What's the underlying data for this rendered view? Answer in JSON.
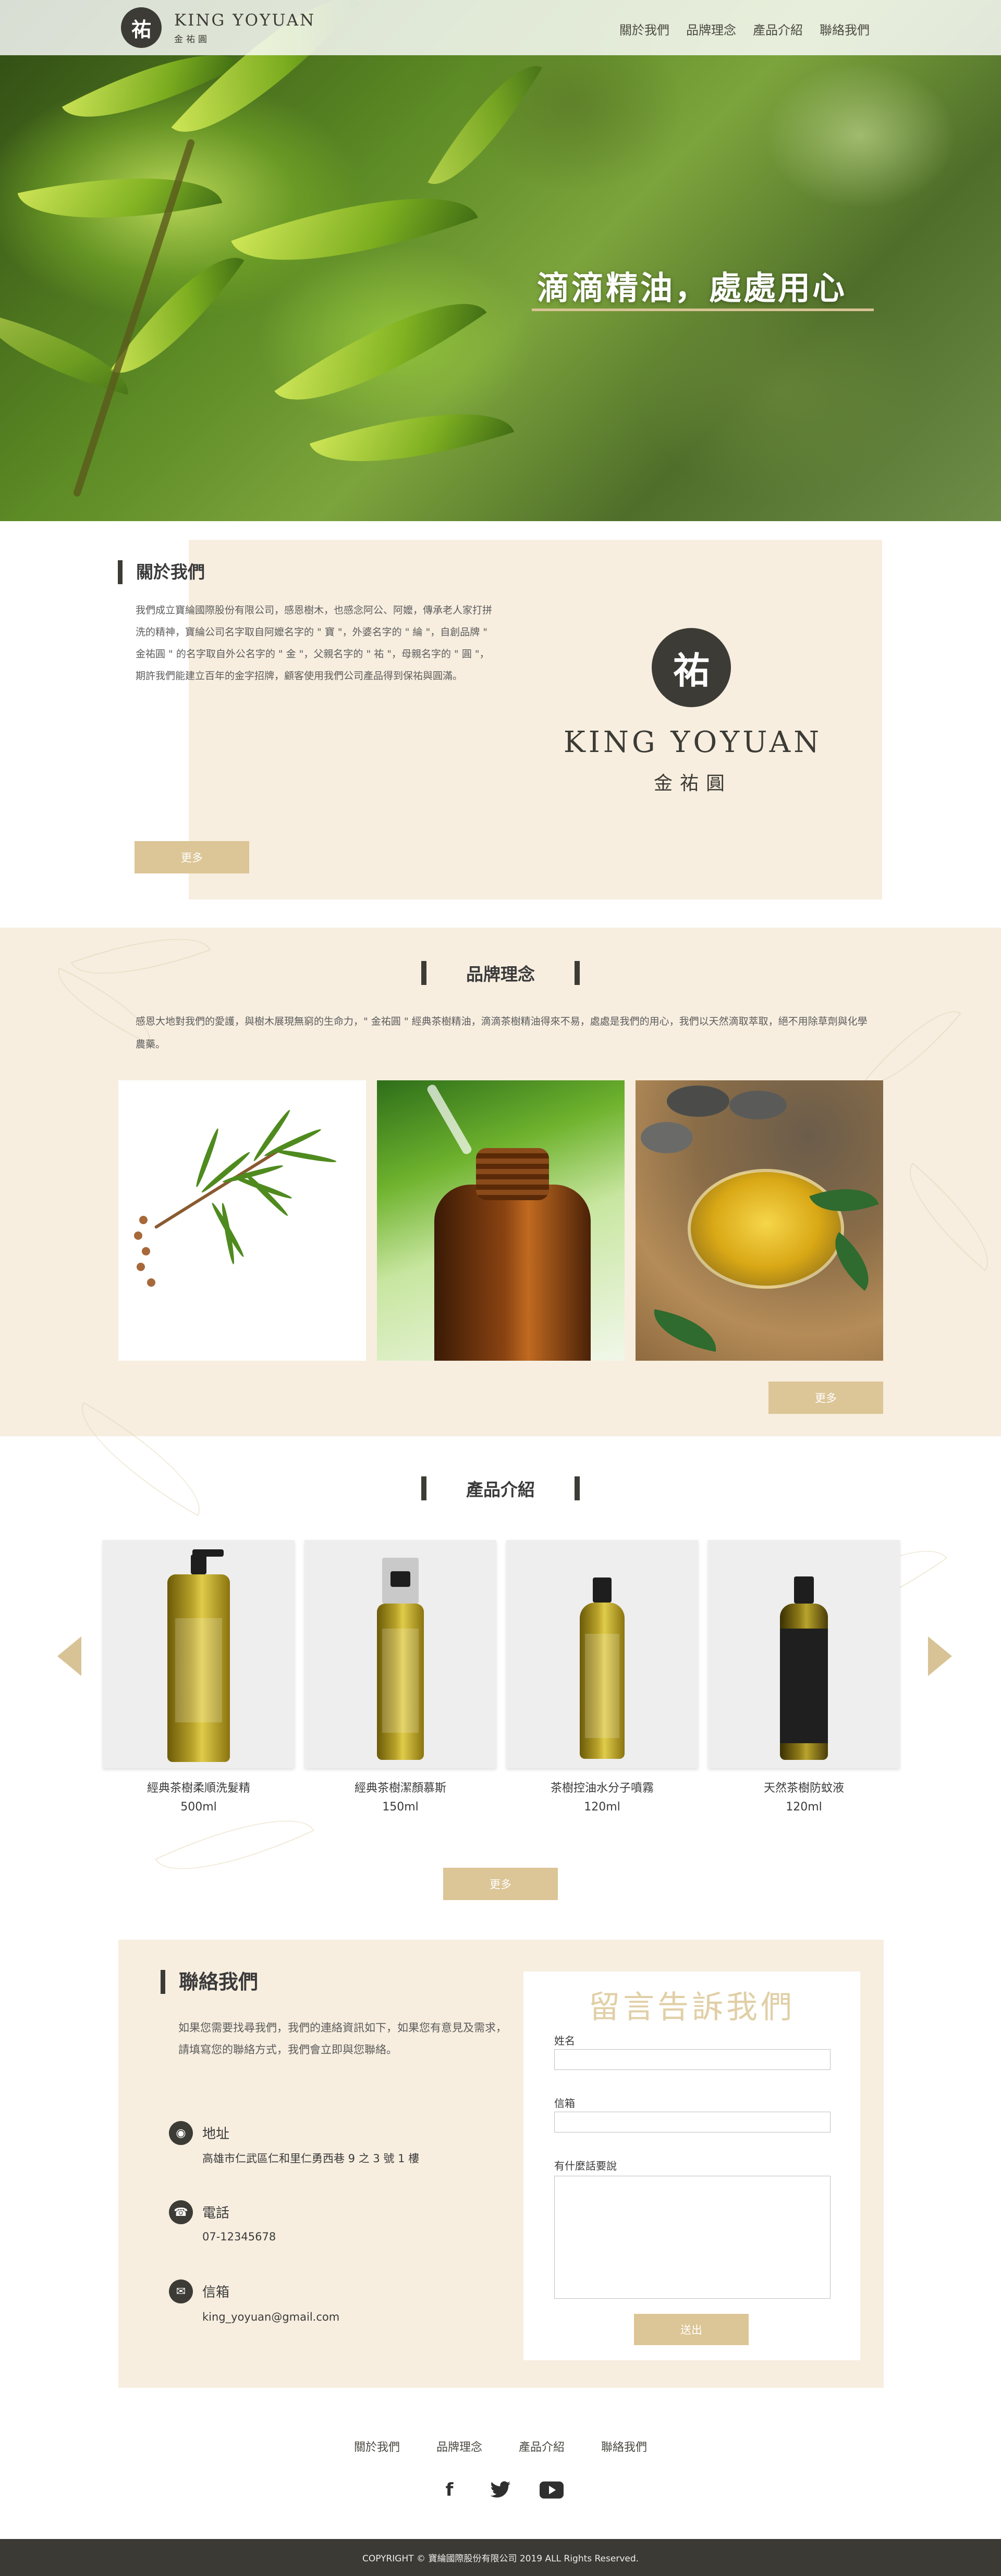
{
  "header": {
    "logo_mark": "祐",
    "logo_en": "KING YOYUAN",
    "logo_zh": "金祐圓",
    "nav": [
      "關於我們",
      "品牌理念",
      "產品介紹",
      "聯絡我們"
    ]
  },
  "hero": {
    "title": "滴滴精油，處處用心"
  },
  "about": {
    "title": "關於我們",
    "text": "我們成立寶綸國際股份有限公司，感恩樹木，也感念阿公、阿嬤，傳承老人家打拼洗的精神，寶綸公司名字取自阿嬤名字的 \" 寶 \"，外婆名字的 \" 綸 \"，自創品牌 \" 金祐圓 \" 的名字取自外公名字的 \" 金 \"，父親名字的 \" 祐 \"，母親名字的 \" 圓 \"，期許我們能建立百年的金字招牌，顧客使用我們公司產品得到保祐與圓滿。",
    "more": "更多",
    "logo_mark": "祐",
    "logo_en": "KING YOYUAN",
    "logo_zh": "金祐圓"
  },
  "brand": {
    "title": "品牌理念",
    "text": "感恩大地對我們的愛護，與樹木展現無窮的生命力，\" 金祐圓 \" 經典茶樹精油，滴滴茶樹精油得來不易，處處是我們的用心，我們以天然滴取萃取，絕不用除草劑與化學農藥。",
    "more": "更多"
  },
  "products": {
    "title": "產品介紹",
    "more": "更多",
    "items": [
      {
        "name": "經典茶樹柔順洗髮精",
        "volume": "500ml"
      },
      {
        "name": "經典茶樹潔顏慕斯",
        "volume": "150ml"
      },
      {
        "name": "茶樹控油水分子噴霧",
        "volume": "120ml"
      },
      {
        "name": "天然茶樹防蚊液",
        "volume": "120ml"
      }
    ]
  },
  "contact": {
    "title": "聯絡我們",
    "text": "如果您需要找尋我們，我們的連絡資訊如下，如果您有意見及需求，請填寫您的聯絡方式，我們會立即與您聯絡。",
    "address_label": "地址",
    "address": "高雄市仁武區仁和里仁勇西巷 9 之 3 號 1 樓",
    "phone_label": "電話",
    "phone": "07-12345678",
    "email_label": "信箱",
    "email": "king_yoyuan@gmail.com",
    "form": {
      "title": "留言告訴我們",
      "name_label": "姓名",
      "email_label": "信箱",
      "message_label": "有什麼話要說",
      "submit": "送出"
    }
  },
  "footer": {
    "nav": [
      "關於我們",
      "品牌理念",
      "產品介紹",
      "聯絡我們"
    ],
    "social_icons": [
      "facebook-icon",
      "twitter-icon",
      "youtube-icon"
    ],
    "copyright": "COPYRIGHT © 寶綸國際股份有限公司 2019 ALL Rights Reserved."
  }
}
